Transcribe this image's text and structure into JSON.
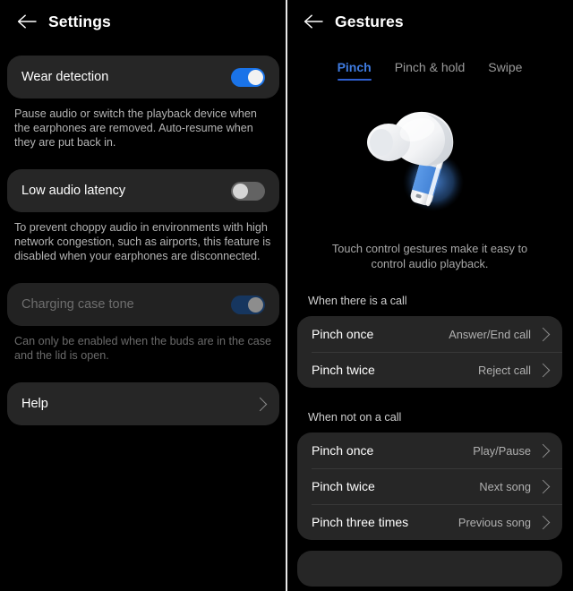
{
  "settings_panel": {
    "back_icon": "back-arrow-icon",
    "title": "Settings",
    "items": [
      {
        "label": "Wear detection",
        "toggle_state": "on",
        "description": "Pause audio or switch the playback device when the earphones are removed. Auto-resume when they are put back in."
      },
      {
        "label": "Low audio latency",
        "toggle_state": "off",
        "description": "To prevent choppy audio in environments with high network congestion, such as airports, this feature is disabled when your earphones are disconnected."
      },
      {
        "label": "Charging case tone",
        "toggle_state": "on-disabled",
        "description": "Can only be enabled when the buds are in the case and the lid is open."
      }
    ],
    "help": {
      "label": "Help",
      "chevron_icon": "chevron-right-icon"
    }
  },
  "gestures_panel": {
    "back_icon": "back-arrow-icon",
    "title": "Gestures",
    "tabs": [
      {
        "label": "Pinch",
        "active": true
      },
      {
        "label": "Pinch & hold",
        "active": false
      },
      {
        "label": "Swipe",
        "active": false
      }
    ],
    "hero_image": "earbud-illustration",
    "hero_description": "Touch control gestures make it easy to control audio playback.",
    "sections": [
      {
        "label": "When there is a call",
        "rows": [
          {
            "label": "Pinch once",
            "value": "Answer/End call",
            "chevron_icon": "chevron-right-icon"
          },
          {
            "label": "Pinch twice",
            "value": "Reject call",
            "chevron_icon": "chevron-right-icon"
          }
        ]
      },
      {
        "label": "When not on a call",
        "rows": [
          {
            "label": "Pinch once",
            "value": "Play/Pause",
            "chevron_icon": "chevron-right-icon"
          },
          {
            "label": "Pinch twice",
            "value": "Next song",
            "chevron_icon": "chevron-right-icon"
          },
          {
            "label": "Pinch three times",
            "value": "Previous song",
            "chevron_icon": "chevron-right-icon"
          }
        ]
      }
    ]
  },
  "colors": {
    "background": "#000000",
    "card": "#262626",
    "toggle_on": "#1a73e8",
    "toggle_off": "#636363",
    "toggle_on_disabled": "#16365f",
    "tab_active": "#3f7be0",
    "text_primary": "#ffffff",
    "text_secondary": "#b0b0b0",
    "earbud_accent": "#6ea8e8"
  }
}
